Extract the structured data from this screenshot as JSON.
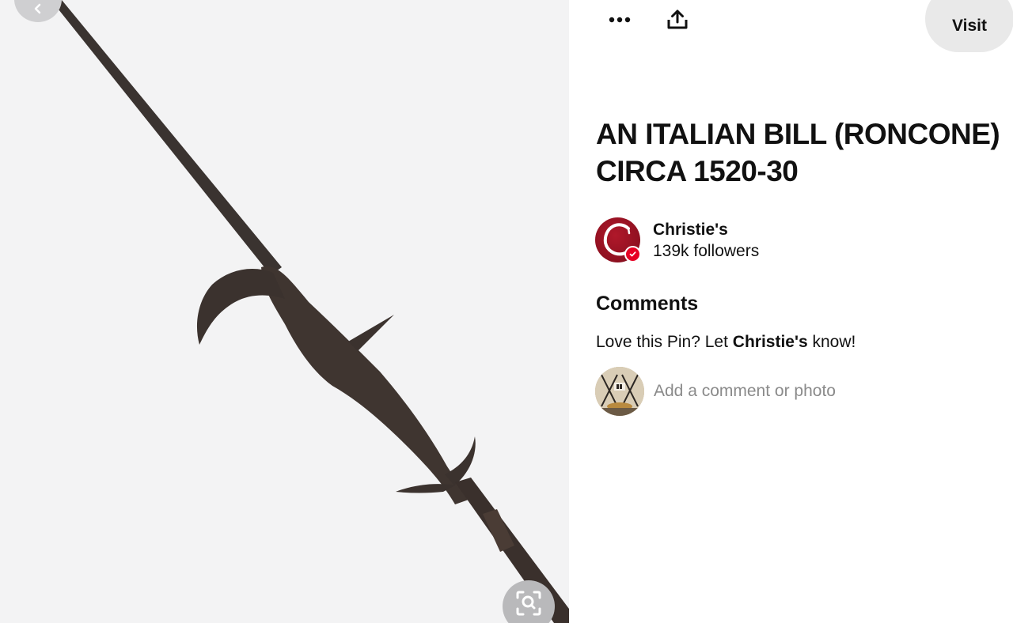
{
  "image_pane": {
    "alt": "AN ITALIAN BILL (RONCONE) CIRCA 1520-30",
    "back_icon": "chevron-left-icon",
    "lens_icon": "visual-search-icon",
    "background": "#f3f3f4",
    "artifact_color": "#3f3530"
  },
  "toolbar": {
    "more_icon": "ellipsis-icon",
    "share_icon": "share-icon",
    "visit_label": "Visit"
  },
  "pin": {
    "title_line1": "AN ITALIAN BILL (RONCONE)",
    "title_line2": "CIRCA 1520-30"
  },
  "creator": {
    "name": "Christie's",
    "followers": "139k followers",
    "avatar_color": "#8e1020",
    "badge_color": "#e60023"
  },
  "comments": {
    "heading": "Comments",
    "prompt_before": "Love this Pin? Let ",
    "prompt_name": "Christie's",
    "prompt_after": " know!",
    "input_placeholder": "Add a comment or photo"
  }
}
